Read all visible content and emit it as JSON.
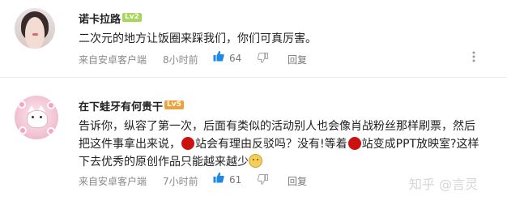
{
  "comments": [
    {
      "username": "诺卡拉路",
      "badge": "Lv2",
      "text": "二次元的地方让饭圈来踩我们，你们可真厉害。",
      "source": "来自安卓客户端",
      "time": "8小时前",
      "likes": "64",
      "reply_label": "回复",
      "badge_color": "#a8d65a"
    },
    {
      "username": "在下蛙牙有何贵干",
      "badge": "Lv5",
      "text_line1": "告诉你，纵容了第一次，后面有类似的活动别人也会像肖战粉丝那样刷票，然后",
      "text_line2_a": "把这件事拿出来说，",
      "text_line2_b": "站会有理由反驳吗？没有!等着",
      "text_line2_c": "站变成PPT放映室?这样",
      "text_line3": "下去优秀的原创作品只能越来越少",
      "source": "来自安卓客户端",
      "time": "7小时前",
      "likes": "61",
      "reply_label": "回复",
      "badge_color": "#f0a23a"
    }
  ],
  "watermark": "知乎 @言灵",
  "icons": {
    "like": "thumbs-up-icon",
    "dislike": "thumbs-down-icon",
    "more": "more-vertical-icon"
  },
  "accent_color": "#1e88e5"
}
